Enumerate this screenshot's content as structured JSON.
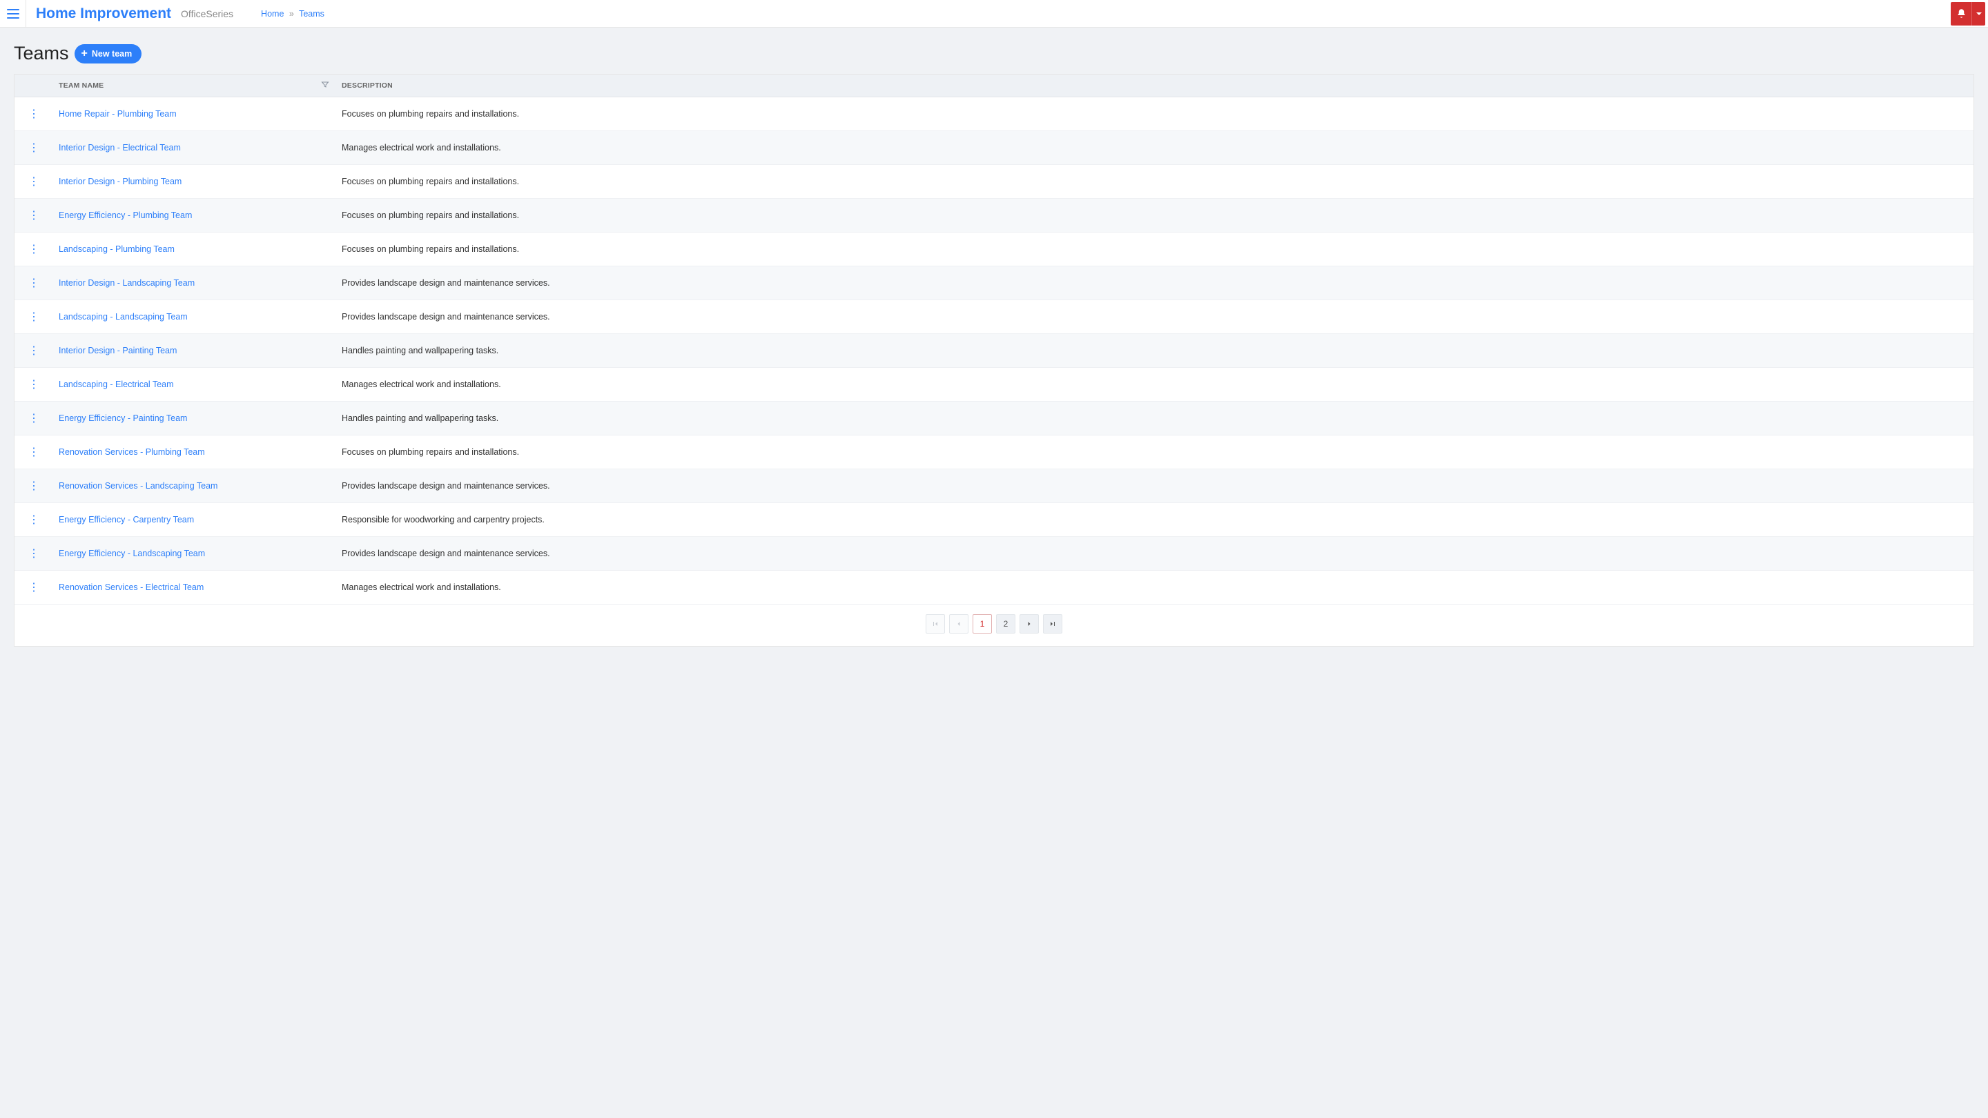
{
  "header": {
    "brand": "Home Improvement",
    "subbrand": "OfficeSeries",
    "breadcrumb": {
      "home": "Home",
      "current": "Teams"
    }
  },
  "page": {
    "title": "Teams",
    "new_button": "New team"
  },
  "table": {
    "columns": {
      "name": "Team Name",
      "description": "Description"
    },
    "rows": [
      {
        "name": "Home Repair - Plumbing Team",
        "description": "Focuses on plumbing repairs and installations."
      },
      {
        "name": "Interior Design - Electrical Team",
        "description": "Manages electrical work and installations."
      },
      {
        "name": "Interior Design - Plumbing Team",
        "description": "Focuses on plumbing repairs and installations."
      },
      {
        "name": "Energy Efficiency - Plumbing Team",
        "description": "Focuses on plumbing repairs and installations."
      },
      {
        "name": "Landscaping - Plumbing Team",
        "description": "Focuses on plumbing repairs and installations."
      },
      {
        "name": "Interior Design - Landscaping Team",
        "description": "Provides landscape design and maintenance services."
      },
      {
        "name": "Landscaping - Landscaping Team",
        "description": "Provides landscape design and maintenance services."
      },
      {
        "name": "Interior Design - Painting Team",
        "description": "Handles painting and wallpapering tasks."
      },
      {
        "name": "Landscaping - Electrical Team",
        "description": "Manages electrical work and installations."
      },
      {
        "name": "Energy Efficiency - Painting Team",
        "description": "Handles painting and wallpapering tasks."
      },
      {
        "name": "Renovation Services - Plumbing Team",
        "description": "Focuses on plumbing repairs and installations."
      },
      {
        "name": "Renovation Services - Landscaping Team",
        "description": "Provides landscape design and maintenance services."
      },
      {
        "name": "Energy Efficiency - Carpentry Team",
        "description": "Responsible for woodworking and carpentry projects."
      },
      {
        "name": "Energy Efficiency - Landscaping Team",
        "description": "Provides landscape design and maintenance services."
      },
      {
        "name": "Renovation Services - Electrical Team",
        "description": "Manages electrical work and installations."
      }
    ]
  },
  "pager": {
    "current": "1",
    "pages": [
      "1",
      "2"
    ]
  }
}
